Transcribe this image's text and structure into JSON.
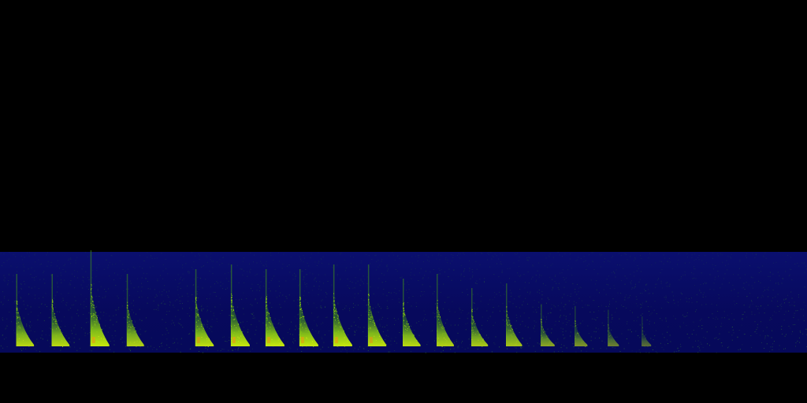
{
  "colors": {
    "background": "#000000",
    "band_top": "#0a0f6e",
    "band_bottom": "#06095a",
    "noise": "#2f6a3a",
    "call_low": "#3e8a1c",
    "call_mid": "#8fcf12",
    "call_high": "#c8e80e",
    "call_peak": "#e0a410"
  },
  "chart_data": {
    "type": "heatmap",
    "title": "",
    "xlabel": "",
    "ylabel": "",
    "description_kind": "spectrogram",
    "calls": [
      {
        "t": 0.02,
        "intensity": 0.9,
        "peak": 0.6
      },
      {
        "t": 0.064,
        "intensity": 0.9,
        "peak": 0.6
      },
      {
        "t": 0.112,
        "intensity": 1.0,
        "peak": 0.85
      },
      {
        "t": 0.157,
        "intensity": 0.85,
        "peak": 0.6
      },
      {
        "t": 0.242,
        "intensity": 0.95,
        "peak": 0.65
      },
      {
        "t": 0.286,
        "intensity": 1.0,
        "peak": 0.7
      },
      {
        "t": 0.329,
        "intensity": 1.0,
        "peak": 0.65
      },
      {
        "t": 0.371,
        "intensity": 1.0,
        "peak": 0.65
      },
      {
        "t": 0.413,
        "intensity": 1.0,
        "peak": 0.7
      },
      {
        "t": 0.456,
        "intensity": 0.95,
        "peak": 0.7
      },
      {
        "t": 0.499,
        "intensity": 0.9,
        "peak": 0.55
      },
      {
        "t": 0.541,
        "intensity": 0.85,
        "peak": 0.6
      },
      {
        "t": 0.584,
        "intensity": 0.8,
        "peak": 0.45
      },
      {
        "t": 0.627,
        "intensity": 0.75,
        "peak": 0.5
      },
      {
        "t": 0.67,
        "intensity": 0.55,
        "peak": 0.28
      },
      {
        "t": 0.712,
        "intensity": 0.45,
        "peak": 0.26
      },
      {
        "t": 0.753,
        "intensity": 0.3,
        "peak": 0.22
      },
      {
        "t": 0.795,
        "intensity": 0.15,
        "peak": 0.15
      }
    ]
  }
}
